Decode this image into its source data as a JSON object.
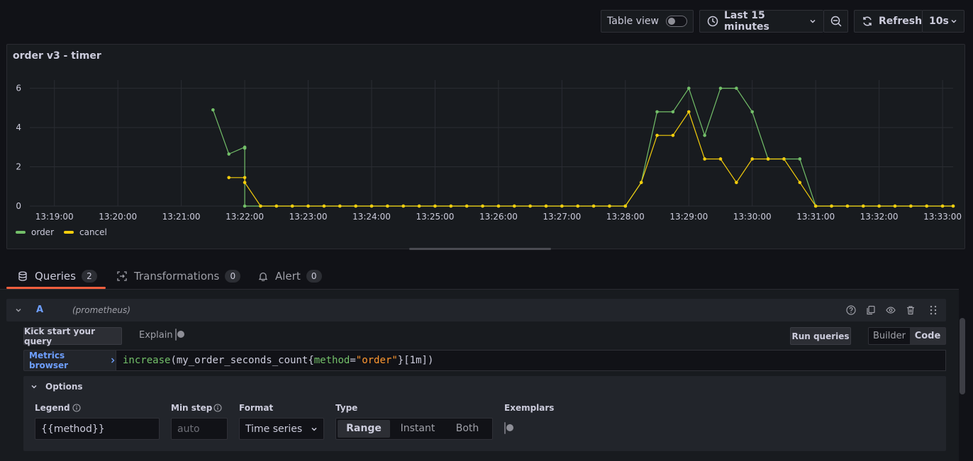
{
  "toolbar": {
    "table_view_label": "Table view",
    "time_range_label": "Last 15 minutes",
    "refresh_label": "Refresh",
    "refresh_interval": "10s"
  },
  "panel": {
    "title": "order v3 - timer"
  },
  "chart_data": {
    "type": "line",
    "title": "order v3 - timer",
    "xlabel": "",
    "ylabel": "",
    "ylim": [
      0,
      6.6
    ],
    "yticks": [
      0,
      2,
      4,
      6
    ],
    "xticks": [
      "13:19:00",
      "13:20:00",
      "13:21:00",
      "13:22:00",
      "13:23:00",
      "13:24:00",
      "13:25:00",
      "13:26:00",
      "13:27:00",
      "13:28:00",
      "13:29:00",
      "13:30:00",
      "13:31:00",
      "13:32:00",
      "13:33:00"
    ],
    "x_start": "13:18:30",
    "x_end": "13:33:10",
    "legend": "bottom-left",
    "grid": true,
    "series": [
      {
        "name": "order",
        "color": "#73bf69",
        "points": [
          [
            "13:21:30",
            4.9
          ],
          [
            "13:21:45",
            2.65
          ],
          [
            "13:22:00",
            3.0
          ],
          [
            "13:22:00",
            2.95
          ],
          [
            "13:22:00",
            0
          ],
          [
            "13:22:15",
            0
          ],
          [
            "13:22:30",
            0
          ],
          [
            "13:22:45",
            0
          ],
          [
            "13:23:00",
            0
          ],
          [
            "13:23:15",
            0
          ],
          [
            "13:23:30",
            0
          ],
          [
            "13:23:45",
            0
          ],
          [
            "13:24:00",
            0
          ],
          [
            "13:24:15",
            0
          ],
          [
            "13:24:30",
            0
          ],
          [
            "13:24:45",
            0
          ],
          [
            "13:25:00",
            0
          ],
          [
            "13:25:15",
            0
          ],
          [
            "13:25:30",
            0
          ],
          [
            "13:25:45",
            0
          ],
          [
            "13:26:00",
            0
          ],
          [
            "13:26:15",
            0
          ],
          [
            "13:26:30",
            0
          ],
          [
            "13:26:45",
            0
          ],
          [
            "13:27:00",
            0
          ],
          [
            "13:27:15",
            0
          ],
          [
            "13:27:30",
            0
          ],
          [
            "13:27:45",
            0
          ],
          [
            "13:28:00",
            0
          ],
          [
            "13:28:00",
            0
          ],
          [
            "13:28:15",
            1.2
          ],
          [
            "13:28:30",
            4.8
          ],
          [
            "13:28:45",
            4.8
          ],
          [
            "13:29:00",
            6.0
          ],
          [
            "13:29:15",
            3.6
          ],
          [
            "13:29:30",
            6.0
          ],
          [
            "13:29:45",
            6.0
          ],
          [
            "13:30:00",
            4.8
          ],
          [
            "13:30:15",
            2.4
          ],
          [
            "13:30:30",
            2.4
          ],
          [
            "13:30:45",
            2.4
          ],
          [
            "13:31:00",
            0
          ],
          [
            "13:31:15",
            0
          ],
          [
            "13:31:30",
            0
          ],
          [
            "13:31:45",
            0
          ],
          [
            "13:32:00",
            0
          ],
          [
            "13:32:15",
            0
          ],
          [
            "13:32:30",
            0
          ],
          [
            "13:32:45",
            0
          ],
          [
            "13:33:00",
            0
          ],
          [
            "13:33:10",
            0
          ]
        ]
      },
      {
        "name": "cancel",
        "color": "#f2cc0c",
        "points": [
          [
            "13:21:45",
            1.45
          ],
          [
            "13:22:00",
            1.45
          ],
          [
            "13:22:00",
            1.2
          ],
          [
            "13:22:15",
            0
          ],
          [
            "13:22:30",
            0
          ],
          [
            "13:22:45",
            0
          ],
          [
            "13:23:00",
            0
          ],
          [
            "13:23:15",
            0
          ],
          [
            "13:23:30",
            0
          ],
          [
            "13:23:45",
            0
          ],
          [
            "13:24:00",
            0
          ],
          [
            "13:24:15",
            0
          ],
          [
            "13:24:30",
            0
          ],
          [
            "13:24:45",
            0
          ],
          [
            "13:25:00",
            0
          ],
          [
            "13:25:15",
            0
          ],
          [
            "13:25:30",
            0
          ],
          [
            "13:25:45",
            0
          ],
          [
            "13:26:00",
            0
          ],
          [
            "13:26:15",
            0
          ],
          [
            "13:26:30",
            0
          ],
          [
            "13:26:45",
            0
          ],
          [
            "13:27:00",
            0
          ],
          [
            "13:27:15",
            0
          ],
          [
            "13:27:30",
            0
          ],
          [
            "13:27:45",
            0
          ],
          [
            "13:28:00",
            0
          ],
          [
            "13:28:15",
            1.2
          ],
          [
            "13:28:30",
            3.6
          ],
          [
            "13:28:45",
            3.6
          ],
          [
            "13:29:00",
            4.8
          ],
          [
            "13:29:15",
            2.4
          ],
          [
            "13:29:30",
            2.4
          ],
          [
            "13:29:45",
            1.2
          ],
          [
            "13:30:00",
            2.4
          ],
          [
            "13:30:15",
            2.4
          ],
          [
            "13:30:30",
            2.4
          ],
          [
            "13:30:45",
            1.2
          ],
          [
            "13:31:00",
            0
          ],
          [
            "13:31:15",
            0
          ],
          [
            "13:31:30",
            0
          ],
          [
            "13:31:45",
            0
          ],
          [
            "13:32:00",
            0
          ],
          [
            "13:32:15",
            0
          ],
          [
            "13:32:30",
            0
          ],
          [
            "13:32:45",
            0
          ],
          [
            "13:33:00",
            0
          ],
          [
            "13:33:10",
            0
          ]
        ]
      }
    ]
  },
  "tabs": [
    {
      "label": "Queries",
      "count": "2",
      "active": true
    },
    {
      "label": "Transformations",
      "count": "0",
      "active": false
    },
    {
      "label": "Alert",
      "count": "0",
      "active": false
    }
  ],
  "query": {
    "ref_id": "A",
    "datasource": "(prometheus)",
    "kick_start_label": "Kick start your query",
    "explain_label": "Explain",
    "run_queries_label": "Run queries",
    "builder_label": "Builder",
    "code_label": "Code",
    "metrics_browser_label": "Metrics browser",
    "expr": {
      "fn": "increase",
      "open": "(",
      "metric": "my_order_seconds_count",
      "brace_open": "{",
      "label_key": "method",
      "eq": "=",
      "label_value": "\"order\"",
      "brace_close": "}",
      "range": "[1m]",
      "close": ")"
    },
    "options": {
      "title": "Options",
      "legend_label": "Legend",
      "legend_value": "{{method}}",
      "min_step_label": "Min step",
      "min_step_placeholder": "auto",
      "format_label": "Format",
      "format_value": "Time series",
      "type_label": "Type",
      "type_options": [
        "Range",
        "Instant",
        "Both"
      ],
      "type_selected": "Range",
      "exemplars_label": "Exemplars"
    }
  },
  "colors": {
    "accent_tab": "#f55f3e",
    "link_blue": "#6e9fff",
    "code_fn": "#73bf69",
    "code_string": "#ff9830"
  }
}
